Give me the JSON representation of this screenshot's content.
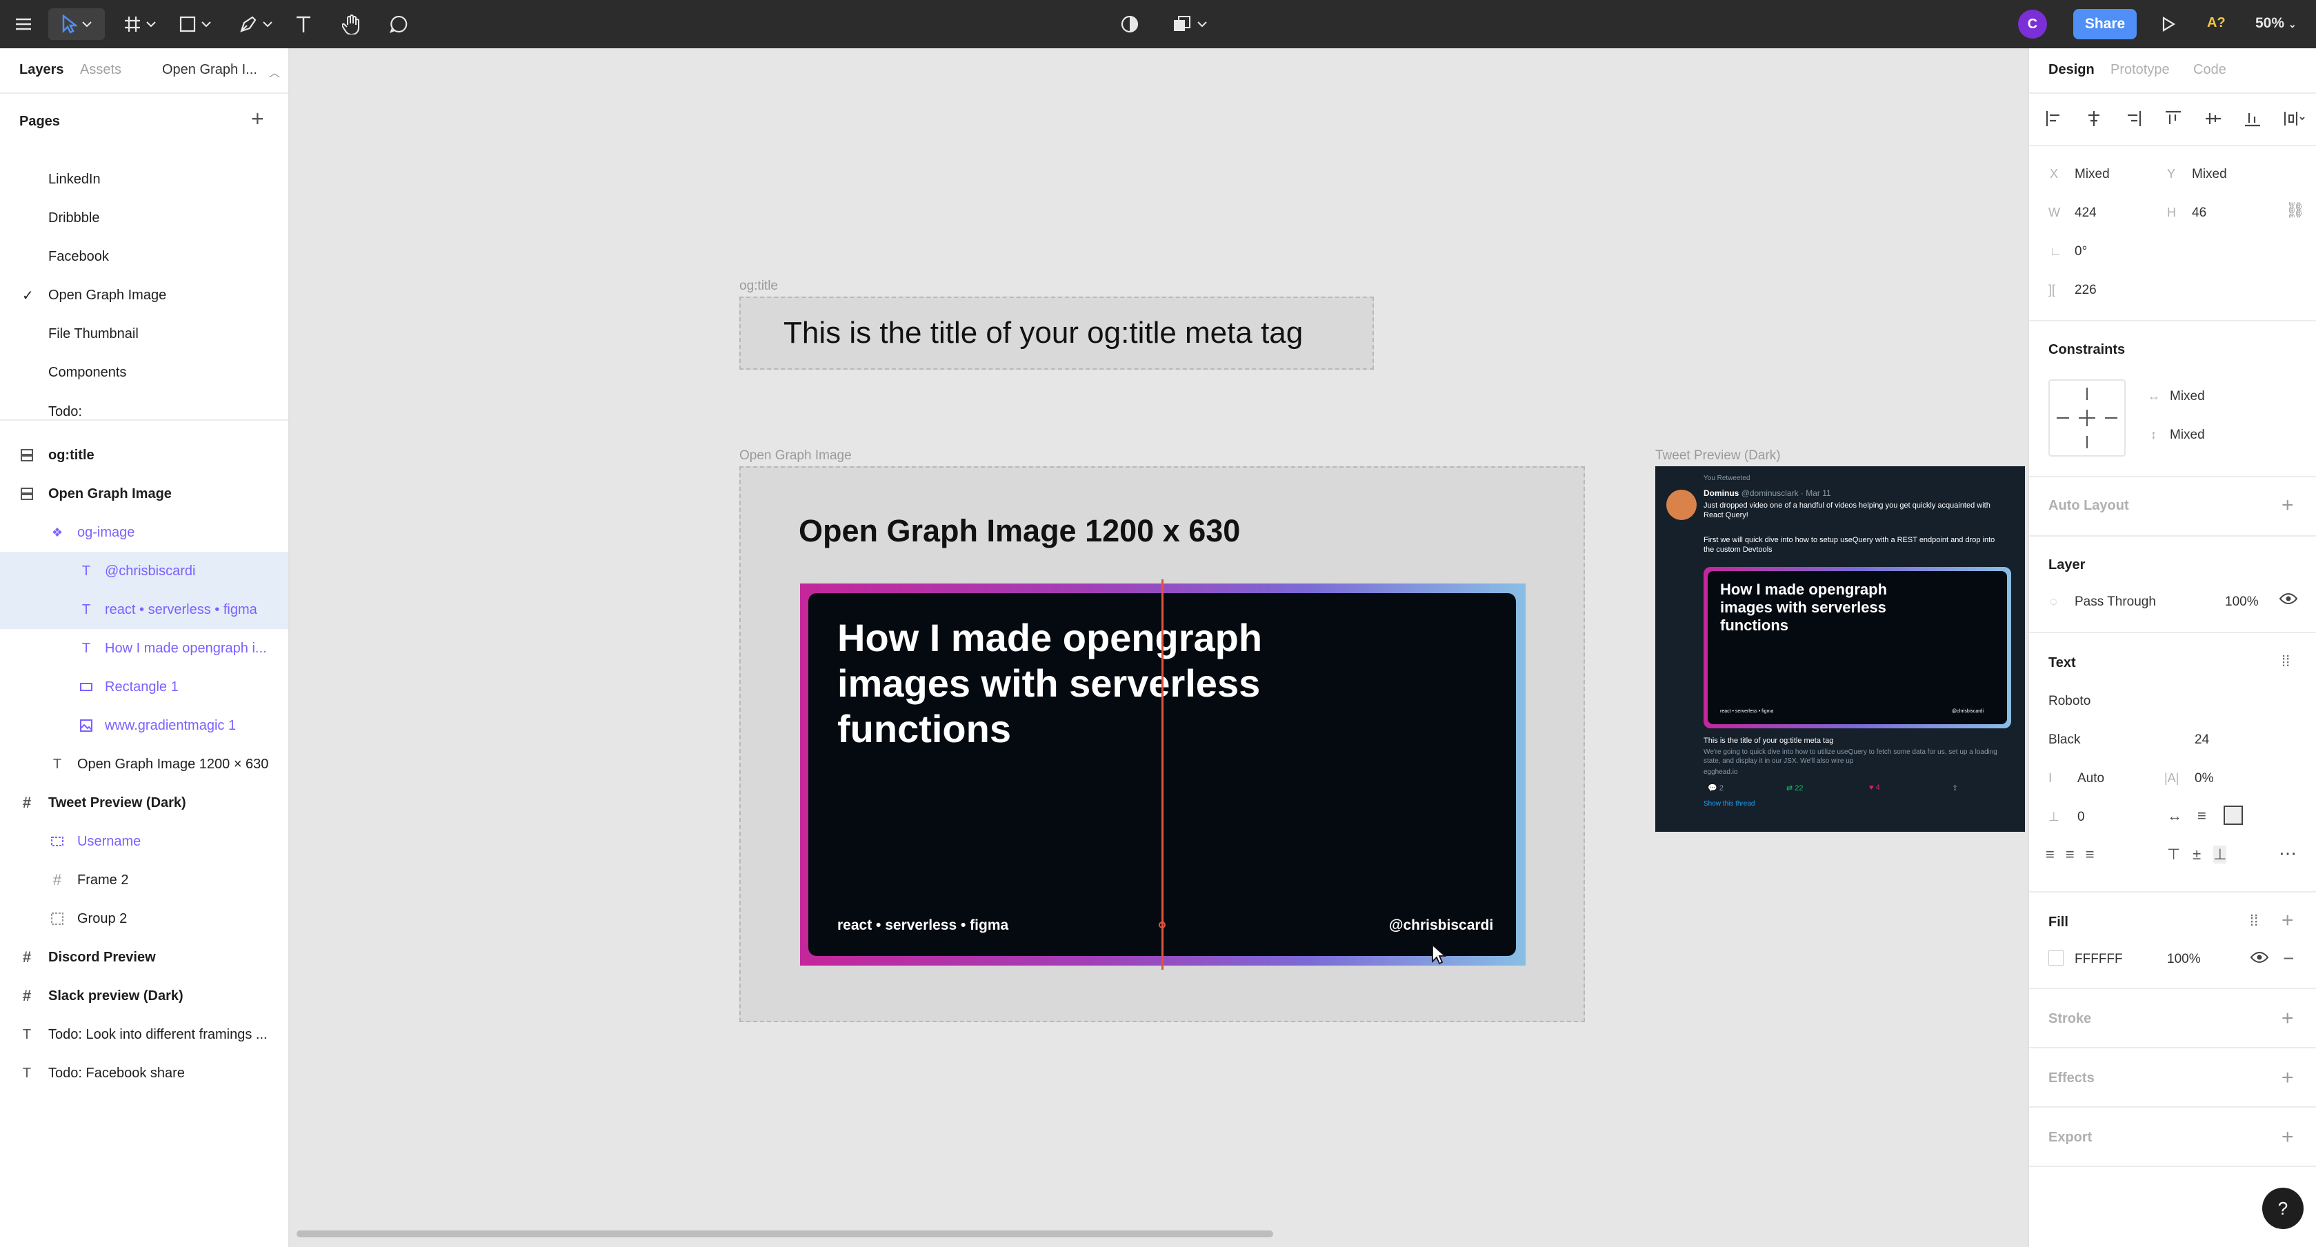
{
  "toolbar": {
    "share_label": "Share",
    "avatar_letter": "C",
    "zoom": "50%",
    "a_label": "A?"
  },
  "left_panel": {
    "tabs": [
      "Layers",
      "Assets",
      "Open Graph I..."
    ],
    "pages_title": "Pages",
    "pages": [
      "LinkedIn",
      "Dribbble",
      "Facebook",
      "Open Graph Image",
      "File Thumbnail",
      "Components",
      "Todo:"
    ],
    "layers": [
      {
        "label": "og:title",
        "icon": "frame-section-icon"
      },
      {
        "label": "Open Graph Image",
        "icon": "frame-section-icon"
      },
      {
        "label": "og-image",
        "icon": "component-icon"
      },
      {
        "label": "@chrisbiscardi",
        "icon": "text-icon"
      },
      {
        "label": "react • serverless • figma",
        "icon": "text-icon"
      },
      {
        "label": "How I made opengraph i...",
        "icon": "text-icon"
      },
      {
        "label": "Rectangle 1",
        "icon": "rectangle-icon"
      },
      {
        "label": "www.gradientmagic 1",
        "icon": "image-icon"
      },
      {
        "label": "Open Graph Image 1200 × 630",
        "icon": "text-icon"
      },
      {
        "label": "Tweet Preview (Dark)",
        "icon": "frame-icon"
      },
      {
        "label": "Username",
        "icon": "component-instance-icon"
      },
      {
        "label": "Frame 2",
        "icon": "frame-icon"
      },
      {
        "label": "Group 2",
        "icon": "group-icon"
      },
      {
        "label": "Discord Preview",
        "icon": "frame-icon"
      },
      {
        "label": "Slack preview (Dark)",
        "icon": "frame-icon"
      },
      {
        "label": "Todo: Look into different framings ...",
        "icon": "text-icon"
      },
      {
        "label": "Todo: Facebook share",
        "icon": "text-icon"
      }
    ]
  },
  "canvas": {
    "og_title_label": "og:title",
    "og_title_text": "This is the title of your og:title meta tag",
    "og_image_label": "Open Graph Image",
    "og_image_heading": "Open Graph Image 1200 x 630",
    "card_title": "How I made opengraph images with serverless functions",
    "card_tags": "react • serverless • figma",
    "card_handle": "@chrisbiscardi",
    "tweet_label": "Tweet Preview (Dark)",
    "tweet": {
      "retweeted": "You Retweeted",
      "name": "Dominus",
      "handle": "@dominusclark · Mar 11",
      "text1": "Just dropped video one of a handful of videos helping you get quickly acquainted with React Query!",
      "text2": "First we will quick dive into how to setup useQuery with a REST endpoint and drop into the custom Devtools",
      "card_title": "How I made opengraph images with serverless functions",
      "card_tags": "react • serverless • figma",
      "card_handle": "@chrisbiscardi",
      "meta_title": "This is the title of your og:title meta tag",
      "meta_desc": "We're going to quick dive into how to utilize useQuery to fetch some data for us, set up a loading state, and display it in our JSX. We'll also wire up",
      "meta_domain": "egghead.io",
      "replies": "2",
      "retweets": "22",
      "likes": "4",
      "show_thread": "Show this thread"
    }
  },
  "right_panel": {
    "tabs": [
      "Design",
      "Prototype",
      "Code"
    ],
    "x_label": "X",
    "x_value": "Mixed",
    "y_label": "Y",
    "y_value": "Mixed",
    "w_label": "W",
    "w_value": "424",
    "h_label": "H",
    "h_value": "46",
    "rotation": "0°",
    "spacing": "226",
    "constraints_title": "Constraints",
    "constraint_h": "Mixed",
    "constraint_v": "Mixed",
    "auto_layout_title": "Auto Layout",
    "layer_title": "Layer",
    "blend_mode": "Pass Through",
    "layer_opacity": "100%",
    "text_title": "Text",
    "font_family": "Roboto",
    "font_weight": "Black",
    "font_size": "24",
    "line_height": "Auto",
    "letter_spacing": "0%",
    "paragraph_spacing": "0",
    "fill_title": "Fill",
    "fill_hex": "FFFFFF",
    "fill_opacity": "100%",
    "stroke_title": "Stroke",
    "effects_title": "Effects",
    "export_title": "Export",
    "help": "?"
  },
  "colors": {
    "toolbar": "#2c2c2c",
    "share": "#4f8ff7",
    "selection": "#e5edf9",
    "purple": "#7b61ff",
    "red_guide": "#e0533d"
  }
}
